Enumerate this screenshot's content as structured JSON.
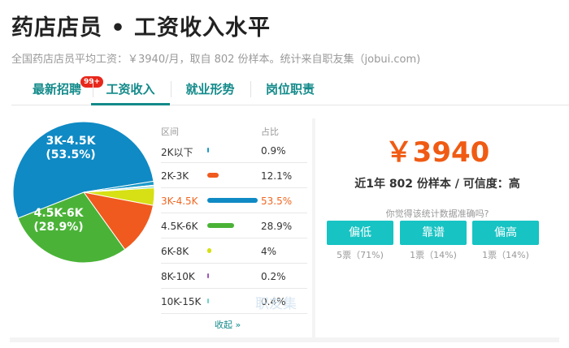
{
  "page": {
    "title": "药店店员 • 工资收入水平",
    "subtitle": "全国药店店员平均工资：￥3940/月，取自 802 份样本。统计来自职友集（jobui.com)"
  },
  "tabs": [
    {
      "label": "最新招聘",
      "badge": "99+"
    },
    {
      "label": "工资收入",
      "active": true
    },
    {
      "label": "就业形势"
    },
    {
      "label": "岗位职责"
    }
  ],
  "distribution": {
    "header_range": "区间",
    "header_share": "占比",
    "rows": [
      {
        "range": "2K以下",
        "share": "0.9%",
        "value": 0.9,
        "color": "#1a9ac9"
      },
      {
        "range": "2K-3K",
        "share": "12.1%",
        "value": 12.1,
        "color": "#f05a1e"
      },
      {
        "range": "3K-4.5K",
        "share": "53.5%",
        "value": 53.5,
        "color": "#0f8ac4",
        "highlight": true
      },
      {
        "range": "4.5K-6K",
        "share": "28.9%",
        "value": 28.9,
        "color": "#4ab337"
      },
      {
        "range": "6K-8K",
        "share": "4%",
        "value": 4,
        "color": "#d6e015"
      },
      {
        "range": "8K-10K",
        "share": "0.2%",
        "value": 0.2,
        "color": "#9b59b6"
      },
      {
        "range": "10K-15K",
        "share": "0.4%",
        "value": 0.4,
        "color": "#6fd3c7"
      }
    ],
    "collapse_label": "收起 »",
    "watermark": "职友集"
  },
  "pie": {
    "labels": [
      {
        "text1": "3K-4.5K",
        "text2": "(53.5%)"
      },
      {
        "text1": "4.5K-6K",
        "text2": "(28.9%)"
      }
    ]
  },
  "summary": {
    "salary": "￥3940",
    "sample_line": "近1年 802 份样本 / 可信度：高",
    "question": "你觉得该统计数据准确吗?",
    "votes": [
      {
        "label": "偏低",
        "count": "5票（71%)"
      },
      {
        "label": "靠谱",
        "count": "1票（14%)"
      },
      {
        "label": "偏高",
        "count": "1票（14%)"
      }
    ]
  }
}
